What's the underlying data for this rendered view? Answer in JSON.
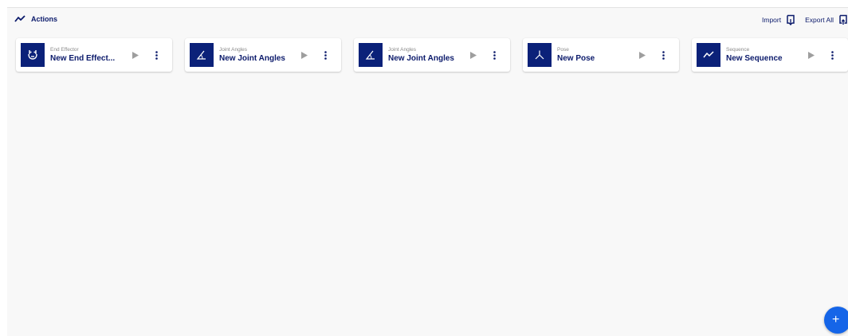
{
  "header": {
    "icon": "trend-line-icon",
    "title": "Actions",
    "import_label": "Import",
    "export_label": "Export All"
  },
  "cards": [
    {
      "type": "End Effector",
      "name": "New End Effect...",
      "icon": "gripper-icon"
    },
    {
      "type": "Joint Angles",
      "name": "New Joint Angles",
      "icon": "angle-icon"
    },
    {
      "type": "Joint Angles",
      "name": "New Joint Angles",
      "icon": "angle-icon"
    },
    {
      "type": "Pose",
      "name": "New Pose",
      "icon": "pose-axes-icon"
    },
    {
      "type": "Sequence",
      "name": "New Sequence",
      "icon": "trend-line-icon"
    }
  ],
  "fab": {
    "label": "+"
  },
  "colors": {
    "navy": "#0b1a6b",
    "thumb": "#0b2179",
    "accent": "#1565e8",
    "background": "#f8f8f8"
  }
}
